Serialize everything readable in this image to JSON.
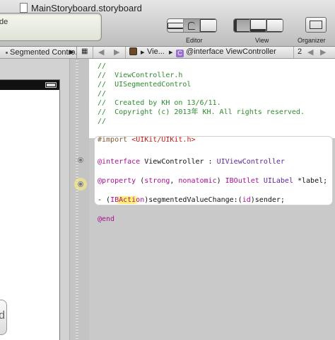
{
  "window": {
    "title": "MainStoryboard.storyboard",
    "activity_text": "de"
  },
  "toolbar": {
    "editor_label": "Editor",
    "view_label": "View",
    "organizer_label": "Organizer"
  },
  "left_jumpbar": {
    "tab_label": "Segmented Contro...",
    "arrow": "▶"
  },
  "right_jumpbar": {
    "nav_back": "◀",
    "nav_forward": "▶",
    "breadcrumb_item": "Vie...",
    "breadcrumb_symbol_letter": "C",
    "breadcrumb_symbol": "@interface ViewController",
    "counter": "2",
    "chevron": "▶"
  },
  "canvas": {
    "device_control_text": "d"
  },
  "code": {
    "header_comments": [
      "//",
      "//  ViewController.h",
      "//  UISegmentedControl",
      "//",
      "//  Created by KH on 13/6/11.",
      "//  Copyright (c) 2013年 KH. All rights reserved.",
      "//"
    ],
    "import_directive": "#import",
    "import_target": "<UIKit/UIKit.h>",
    "interface_kw": "@interface",
    "interface_name": " ViewController : ",
    "interface_super": "UIViewController",
    "property_kw": "@property",
    "property_attrs_open": " (",
    "property_attr_strong": "strong",
    "property_attr_sep": ", ",
    "property_attr_nonatomic": "nonatomic",
    "property_attrs_close": ") ",
    "property_outlet": "IBOutlet",
    "property_type": " UILabel ",
    "property_rest": "*label;",
    "action_prefix": "- (",
    "action_ib": "IBAction",
    "action_mid": ")segmentedValueChange:(",
    "action_id": "id",
    "action_end": ")sender;",
    "end_kw": "@end"
  }
}
